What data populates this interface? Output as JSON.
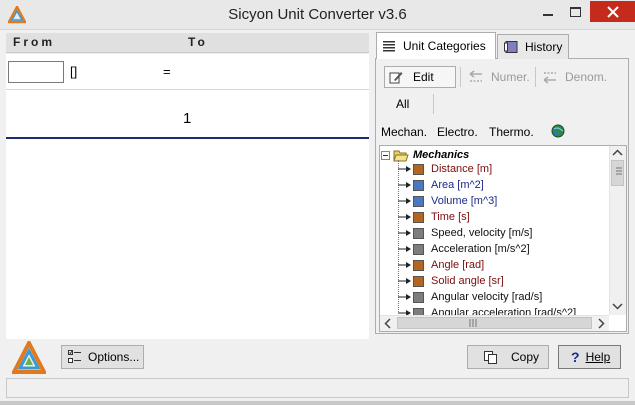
{
  "window": {
    "title": "Sicyon Unit Converter v3.6"
  },
  "converter": {
    "from_header": "From",
    "to_header": "To",
    "input_value": "",
    "from_unit": "[]",
    "equals": "=",
    "result": "1"
  },
  "tabs": [
    {
      "label": "Unit Categories",
      "icon": "list-icon",
      "active": true
    },
    {
      "label": "History",
      "icon": "history-icon",
      "active": false
    }
  ],
  "toolbar": {
    "edit_label": "Edit",
    "numer_label": "Numer.",
    "denom_label": "Denom.",
    "all_label": "All"
  },
  "categories": [
    "Mechan.",
    "Electro.",
    "Thermo."
  ],
  "tree": {
    "root": "Mechanics",
    "items": [
      {
        "label": "Distance [m]",
        "color": "#b5651d",
        "text_color": "#7b0d0d"
      },
      {
        "label": "Area [m^2]",
        "color": "#4a78c2",
        "text_color": "#1a2a8a"
      },
      {
        "label": "Volume [m^3]",
        "color": "#4a78c2",
        "text_color": "#1a2a8a"
      },
      {
        "label": "Time [s]",
        "color": "#b5651d",
        "text_color": "#7b0d0d"
      },
      {
        "label": "Speed, velocity [m/s]",
        "color": "#7d7d7d",
        "text_color": "#111111"
      },
      {
        "label": "Acceleration [m/s^2]",
        "color": "#7d7d7d",
        "text_color": "#111111"
      },
      {
        "label": "Angle [rad]",
        "color": "#b5651d",
        "text_color": "#7b0d0d"
      },
      {
        "label": "Solid angle [sr]",
        "color": "#b5651d",
        "text_color": "#7b0d0d"
      },
      {
        "label": "Angular velocity [rad/s]",
        "color": "#7d7d7d",
        "text_color": "#111111"
      },
      {
        "label": "Angular acceleration [rad/s^2]",
        "color": "#7d7d7d",
        "text_color": "#111111"
      }
    ]
  },
  "buttons": {
    "options_label": "Options...",
    "copy_label": "Copy",
    "help_label": "Help"
  }
}
